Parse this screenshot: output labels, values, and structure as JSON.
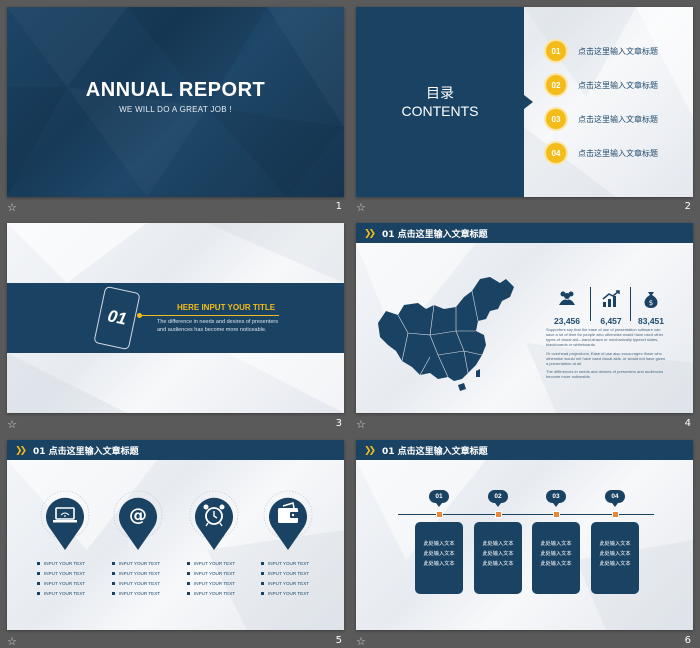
{
  "slides": [
    {
      "num": "1",
      "title": "ANNUAL REPORT",
      "subtitle": "WE WILL DO A GREAT JOB !"
    },
    {
      "num": "2",
      "title_zh": "目录",
      "title_en": "CONTENTS",
      "items": [
        {
          "badge": "01",
          "label": "点击这里输入文章标题"
        },
        {
          "badge": "02",
          "label": "点击这里输入文章标题"
        },
        {
          "badge": "03",
          "label": "点击这里输入文章标题"
        },
        {
          "badge": "04",
          "label": "点击这里输入文章标题"
        }
      ]
    },
    {
      "num": "3",
      "card": "01",
      "heading": "HERE INPUT YOUR TITLE",
      "body": "The difference in needs and desires of presenters and audiences has become more noticeable."
    },
    {
      "num": "4",
      "header": "01 点击这里输入文章标题",
      "stats": [
        {
          "icon": "people-icon",
          "value": "23,456"
        },
        {
          "icon": "chart-growth-icon",
          "value": "6,457"
        },
        {
          "icon": "money-bag-icon",
          "value": "83,451"
        }
      ],
      "paragraphs": [
        "Supporters say that the ease of use of presentation software can save a lot of time for people who otherwise would have used other types of visual aid—hand-drawn or mechanically typeset slides, blackboards or whiteboards.",
        "Or overhead projections. Ease of use also encourages those who otherwise would not have used visual aids, or would not have given a presentation at all.",
        "The differences in needs and desires of presenters and audiences become more noticeable."
      ]
    },
    {
      "num": "5",
      "header": "01 点击这里输入文章标题",
      "columns": [
        {
          "icon": "laptop-wifi-icon",
          "items": [
            "INPUT YOUR TEXT",
            "INPUT YOUR TEXT",
            "INPUT YOUR TEXT",
            "INPUT YOUR TEXT"
          ]
        },
        {
          "icon": "at-sign-icon",
          "items": [
            "INPUT YOUR TEXT",
            "INPUT YOUR TEXT",
            "INPUT YOUR TEXT",
            "INPUT YOUR TEXT"
          ]
        },
        {
          "icon": "alarm-clock-icon",
          "items": [
            "INPUT YOUR TEXT",
            "INPUT YOUR TEXT",
            "INPUT YOUR TEXT",
            "INPUT YOUR TEXT"
          ]
        },
        {
          "icon": "wallet-icon",
          "items": [
            "INPUT YOUR TEXT",
            "INPUT YOUR TEXT",
            "INPUT YOUR TEXT",
            "INPUT YOUR TEXT"
          ]
        }
      ]
    },
    {
      "num": "6",
      "header": "01 点击这里输入文章标题",
      "steps": [
        {
          "badge": "01",
          "lines": [
            "此处输入文本",
            "此处输入文本",
            "此处输入文本"
          ]
        },
        {
          "badge": "02",
          "lines": [
            "此处输入文本",
            "此处输入文本",
            "此处输入文本"
          ]
        },
        {
          "badge": "03",
          "lines": [
            "此处输入文本",
            "此处输入文本",
            "此处输入文本"
          ]
        },
        {
          "badge": "04",
          "lines": [
            "此处输入文本",
            "此处输入文本",
            "此处输入文本"
          ]
        }
      ]
    }
  ],
  "colors": {
    "navy": "#1a4263",
    "accent": "#f3bc1a",
    "background": "#5a5a5a",
    "node": "#e8883a"
  }
}
